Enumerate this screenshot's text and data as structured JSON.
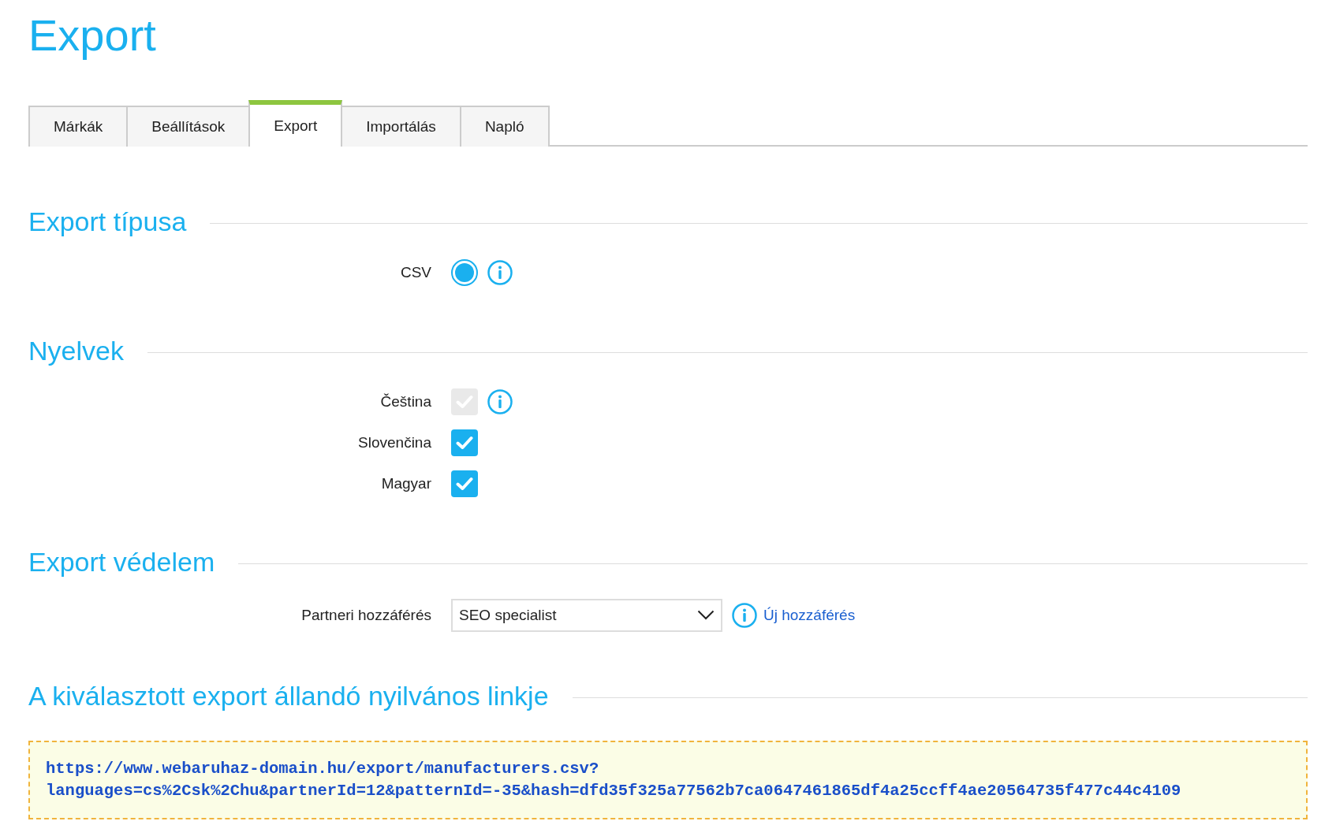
{
  "title": "Export",
  "tabs": [
    {
      "label": "Márkák",
      "selected": false
    },
    {
      "label": "Beállítások",
      "selected": false
    },
    {
      "label": "Export",
      "selected": true
    },
    {
      "label": "Importálás",
      "selected": false
    },
    {
      "label": "Napló",
      "selected": false
    }
  ],
  "sections": [
    {
      "title": "Export típusa",
      "rows": [
        {
          "kind": "radio",
          "label": "CSV",
          "selected": true,
          "info": true
        }
      ]
    },
    {
      "title": "Nyelvek",
      "rows": [
        {
          "kind": "checkbox",
          "label": "Čeština",
          "checked": true,
          "disabled": true,
          "info": true
        },
        {
          "kind": "checkbox",
          "label": "Slovenčina",
          "checked": true,
          "disabled": false,
          "info": false
        },
        {
          "kind": "checkbox",
          "label": "Magyar",
          "checked": true,
          "disabled": false,
          "info": false
        }
      ]
    },
    {
      "title": "Export védelem",
      "rows": [
        {
          "kind": "select",
          "label": "Partneri hozzáférés",
          "value": "SEO specialist",
          "info": true,
          "link": "Új hozzáférés"
        }
      ]
    },
    {
      "title": "A kiválasztott export állandó nyilvános linkje",
      "link_lines": [
        "https://www.webaruhaz-domain.hu/export/manufacturers.csv?",
        "languages=cs%2Csk%2Chu&partnerId=12&patternId=-35&hash=dfd35f325a77562b7ca0647461865df4a25ccff4ae20564735f477c44c4109"
      ]
    }
  ]
}
